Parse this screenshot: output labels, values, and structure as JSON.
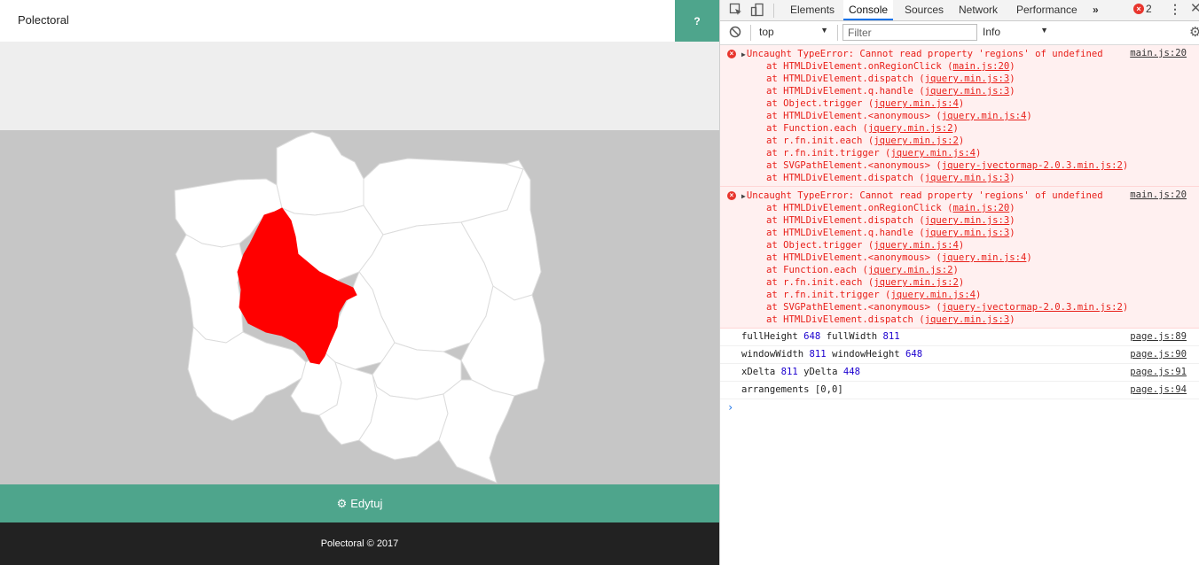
{
  "app": {
    "title": "Polectoral",
    "help_label": "?",
    "edit_label": "Edytuj",
    "footer_text": "Polectoral © 2017",
    "colors": {
      "accent": "#4ea58c",
      "highlight": "#ff0000",
      "map_bg": "#c6c6c6",
      "footer_bg": "#222222"
    }
  },
  "map": {
    "regions": [
      {
        "name": "zachodniopomorskie"
      },
      {
        "name": "pomorskie"
      },
      {
        "name": "warminsko-mazurskie"
      },
      {
        "name": "podlaskie"
      },
      {
        "name": "lubuskie"
      },
      {
        "name": "wielkopolskie",
        "selected": true
      },
      {
        "name": "kujawsko-pomorskie"
      },
      {
        "name": "mazowieckie"
      },
      {
        "name": "lodzkie"
      },
      {
        "name": "lubelskie"
      },
      {
        "name": "dolnoslaskie"
      },
      {
        "name": "opolskie"
      },
      {
        "name": "slaskie"
      },
      {
        "name": "swietokrzyskie"
      },
      {
        "name": "malopolskie"
      },
      {
        "name": "podkarpackie"
      }
    ]
  },
  "devtools": {
    "tabs": [
      "Elements",
      "Console",
      "Sources",
      "Network",
      "Performance"
    ],
    "active_tab": "Console",
    "more_tabs": "»",
    "error_count": "2",
    "context": "top",
    "filter_placeholder": "Filter",
    "level": "Info",
    "errors": [
      {
        "message": "Uncaught TypeError: Cannot read property 'regions' of undefined",
        "location": "main.js:20",
        "frames": [
          {
            "fn": "HTMLDivElement.onRegionClick",
            "src": "main.js:20"
          },
          {
            "fn": "HTMLDivElement.dispatch",
            "src": "jquery.min.js:3"
          },
          {
            "fn": "HTMLDivElement.q.handle",
            "src": "jquery.min.js:3"
          },
          {
            "fn": "Object.trigger",
            "src": "jquery.min.js:4"
          },
          {
            "fn": "HTMLDivElement.<anonymous>",
            "src": "jquery.min.js:4"
          },
          {
            "fn": "Function.each",
            "src": "jquery.min.js:2"
          },
          {
            "fn": "r.fn.init.each",
            "src": "jquery.min.js:2"
          },
          {
            "fn": "r.fn.init.trigger",
            "src": "jquery.min.js:4"
          },
          {
            "fn": "SVGPathElement.<anonymous>",
            "src": "jquery-jvectormap-2.0.3.min.js:2"
          },
          {
            "fn": "HTMLDivElement.dispatch",
            "src": "jquery.min.js:3"
          }
        ]
      },
      {
        "message": "Uncaught TypeError: Cannot read property 'regions' of undefined",
        "location": "main.js:20",
        "frames": [
          {
            "fn": "HTMLDivElement.onRegionClick",
            "src": "main.js:20"
          },
          {
            "fn": "HTMLDivElement.dispatch",
            "src": "jquery.min.js:3"
          },
          {
            "fn": "HTMLDivElement.q.handle",
            "src": "jquery.min.js:3"
          },
          {
            "fn": "Object.trigger",
            "src": "jquery.min.js:4"
          },
          {
            "fn": "HTMLDivElement.<anonymous>",
            "src": "jquery.min.js:4"
          },
          {
            "fn": "Function.each",
            "src": "jquery.min.js:2"
          },
          {
            "fn": "r.fn.init.each",
            "src": "jquery.min.js:2"
          },
          {
            "fn": "r.fn.init.trigger",
            "src": "jquery.min.js:4"
          },
          {
            "fn": "SVGPathElement.<anonymous>",
            "src": "jquery-jvectormap-2.0.3.min.js:2"
          },
          {
            "fn": "HTMLDivElement.dispatch",
            "src": "jquery.min.js:3"
          }
        ]
      }
    ],
    "logs": [
      {
        "parts": [
          {
            "t": "fullHeight "
          },
          {
            "t": "648",
            "num": true
          },
          {
            "t": " fullWidth "
          },
          {
            "t": "811",
            "num": true
          }
        ],
        "location": "page.js:89"
      },
      {
        "parts": [
          {
            "t": "windowWidth "
          },
          {
            "t": "811",
            "num": true
          },
          {
            "t": " windowHeight "
          },
          {
            "t": "648",
            "num": true
          }
        ],
        "location": "page.js:90"
      },
      {
        "parts": [
          {
            "t": "xDelta "
          },
          {
            "t": "811",
            "num": true
          },
          {
            "t": " yDelta "
          },
          {
            "t": "448",
            "num": true
          }
        ],
        "location": "page.js:91"
      },
      {
        "parts": [
          {
            "t": "arrangements [0,0]"
          }
        ],
        "location": "page.js:94"
      }
    ],
    "prompt": "›"
  }
}
